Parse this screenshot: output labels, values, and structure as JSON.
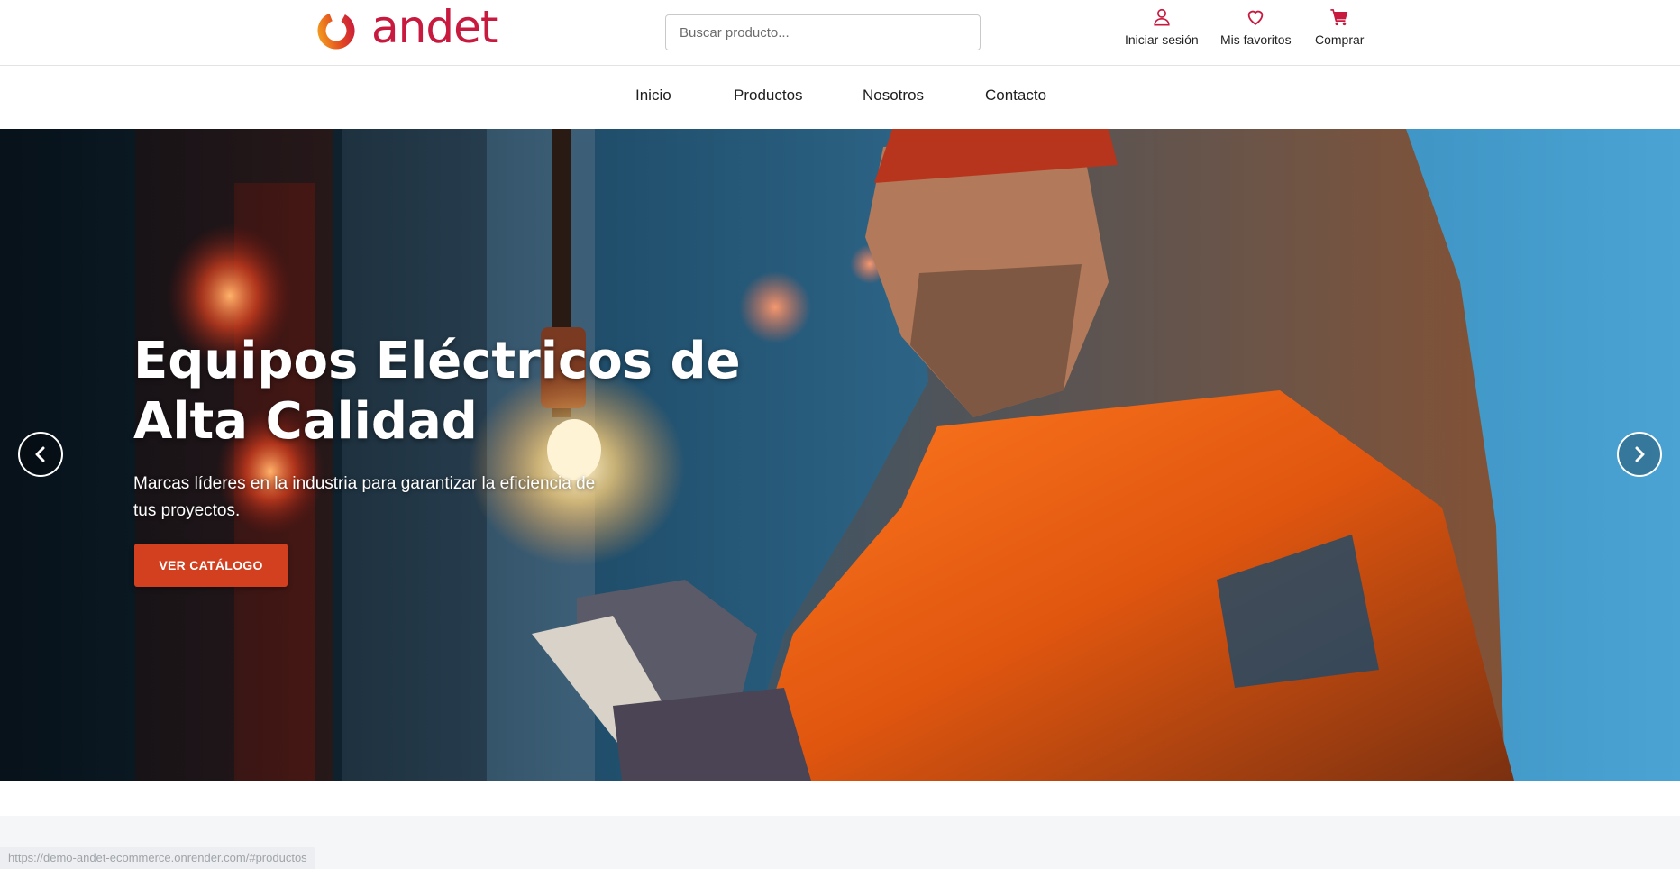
{
  "brand": {
    "name": "andet",
    "text_color": "#c8193f",
    "ring_colors": [
      "#f4a21f",
      "#e2481f",
      "#c8193f"
    ]
  },
  "search": {
    "placeholder": "Buscar producto...",
    "value": ""
  },
  "header_actions": [
    {
      "label": "Iniciar sesión",
      "icon": "user-icon"
    },
    {
      "label": "Mis favoritos",
      "icon": "heart-icon"
    },
    {
      "label": "Comprar",
      "icon": "cart-icon"
    }
  ],
  "icon_color": "#c8193f",
  "nav": {
    "items": [
      {
        "label": "Inicio"
      },
      {
        "label": "Productos"
      },
      {
        "label": "Nosotros"
      },
      {
        "label": "Contacto"
      }
    ]
  },
  "hero": {
    "title": "Equipos Eléctricos de Alta Calidad",
    "subtitle": "Marcas líderes en la industria para garantizar la eficiencia de tus proyectos.",
    "cta_label": "VER CATÁLOGO",
    "cta_color": "#d2401f",
    "prev_icon": "chevron-left-icon",
    "next_icon": "chevron-right-icon"
  },
  "status_bar": {
    "url": "https://demo-andet-ecommerce.onrender.com/#productos"
  }
}
